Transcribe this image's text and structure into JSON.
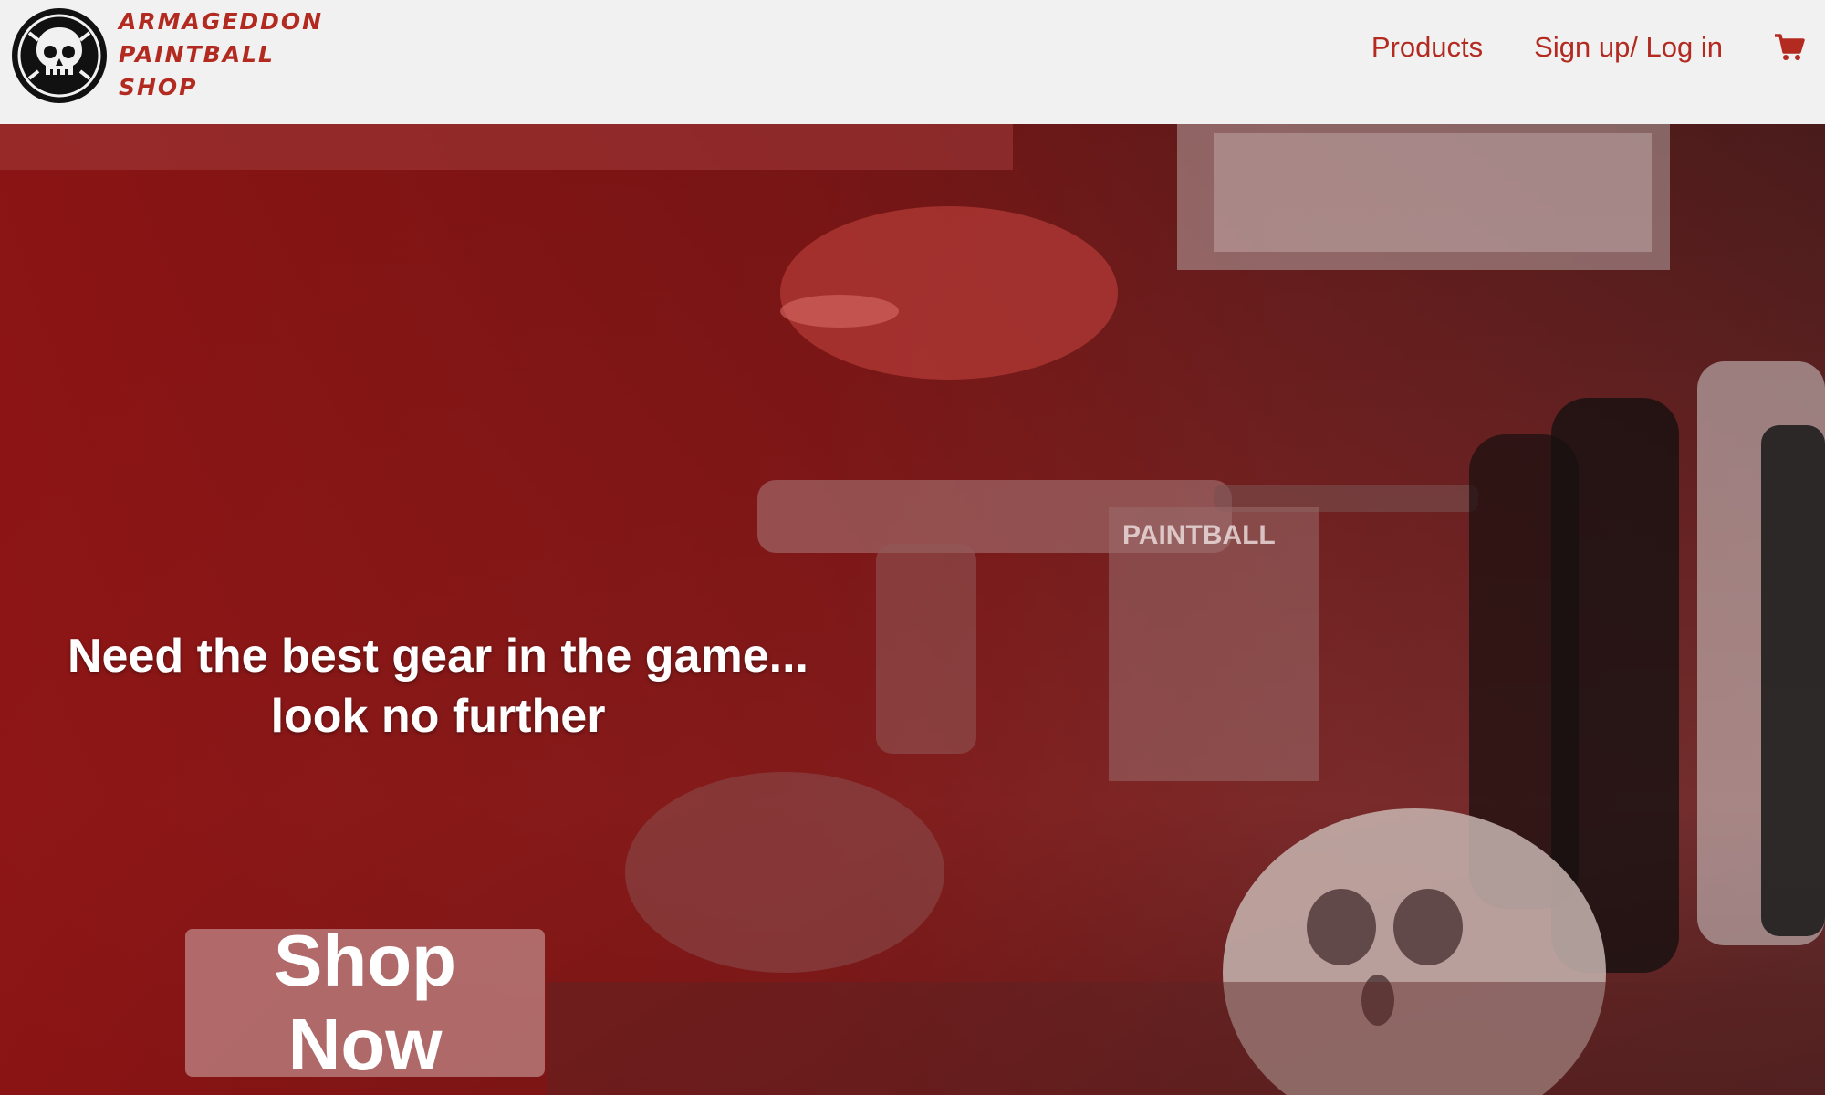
{
  "brand": {
    "name_lines": [
      "Armageddon",
      "Paintball",
      "Shop"
    ],
    "logo_icon": "skull-icon"
  },
  "nav": {
    "products_label": "Products",
    "signup_label": "Sign up/ Log in",
    "cart_icon": "cart-icon"
  },
  "hero": {
    "headline_line1": "Need the best gear in the game...",
    "headline_line2": "look no further",
    "cta_label": "Shop Now",
    "background_tint": "#8b1a1a"
  },
  "colors": {
    "accent": "#b22a20",
    "header_bg": "#f1f1f1"
  }
}
